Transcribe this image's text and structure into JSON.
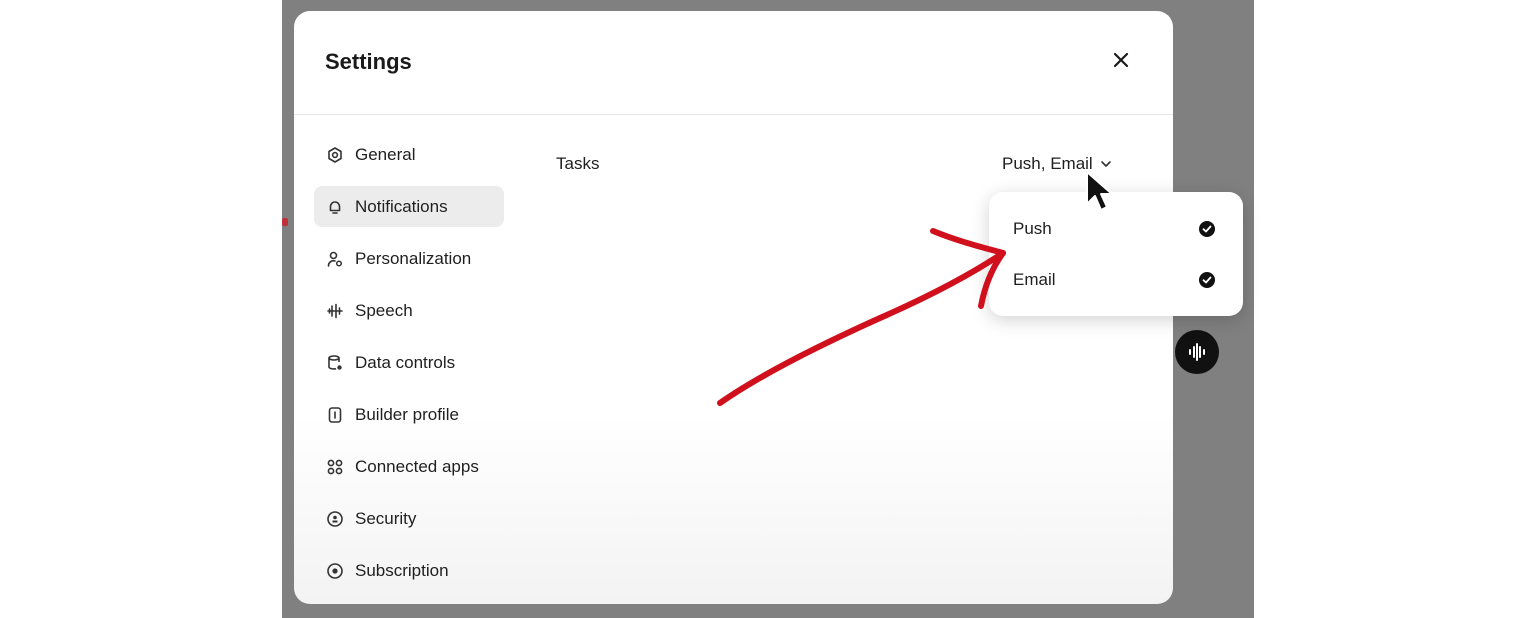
{
  "modal": {
    "title": "Settings",
    "close_icon": "close-icon"
  },
  "sidebar": {
    "items": [
      {
        "label": "General",
        "icon": "gear-icon",
        "active": false
      },
      {
        "label": "Notifications",
        "icon": "bell-icon",
        "active": true
      },
      {
        "label": "Personalization",
        "icon": "person-icon",
        "active": false
      },
      {
        "label": "Speech",
        "icon": "waveform-icon",
        "active": false
      },
      {
        "label": "Data controls",
        "icon": "database-icon",
        "active": false
      },
      {
        "label": "Builder profile",
        "icon": "id-card-icon",
        "active": false
      },
      {
        "label": "Connected apps",
        "icon": "apps-grid-icon",
        "active": false
      },
      {
        "label": "Security",
        "icon": "shield-lock-icon",
        "active": false
      },
      {
        "label": "Subscription",
        "icon": "subscription-icon",
        "active": false
      }
    ]
  },
  "notifications": {
    "setting_label": "Tasks",
    "selected_value": "Push, Email",
    "options": [
      {
        "label": "Push",
        "checked": true
      },
      {
        "label": "Email",
        "checked": true
      }
    ]
  },
  "colors": {
    "backdrop": "#808080",
    "annotation_arrow": "#d0101c",
    "active_item": "#ececec"
  }
}
